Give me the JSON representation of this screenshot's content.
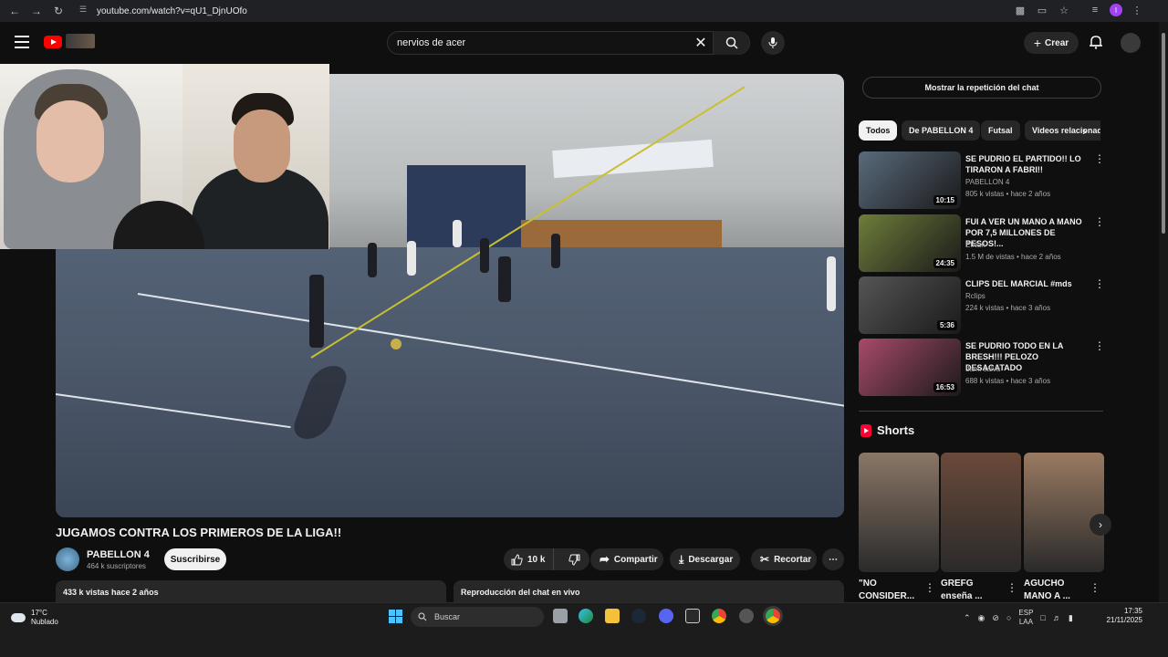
{
  "browser": {
    "url": "youtube.com/watch?v=qU1_DjnUOfo",
    "profile_initial": "I"
  },
  "header": {
    "search_value": "nervios de acer",
    "create_label": "Crear"
  },
  "video": {
    "title": "JUGAMOS CONTRA LOS PRIMEROS DE LA LIGA!!",
    "channel": "PABELLON 4",
    "subscribers": "464 k suscriptores",
    "subscribe_label": "Suscribirse",
    "likes": "10 k",
    "share_label": "Compartir",
    "download_label": "Descargar",
    "clip_label": "Recortar",
    "views_line": "433 k vistas  hace 2 años",
    "chat_replay_label": "Reproducción del chat en vivo"
  },
  "sidebar": {
    "chat_button": "Mostrar la repetición del chat",
    "chips": [
      "Todos",
      "De PABELLON 4",
      "Futsal",
      "Videos relacionados"
    ],
    "recommendations": [
      {
        "title": "SE PUDRIO EL PARTIDO!! LO TIRARON A FABRI!!",
        "channel": "PABELLON 4",
        "meta": "805 k vistas • hace 2 años",
        "duration": "10:15",
        "thumb_color": "#5a6b7c"
      },
      {
        "title": "FUI A VER UN MANO A MANO POR 7,5 MILLONES DE PESOS!...",
        "channel": "ElNari",
        "meta": "1.5 M de vistas • hace 2 años",
        "duration": "24:35",
        "thumb_color": "#6e7d3a"
      },
      {
        "title": "CLIPS DEL MARCIAL #mds",
        "channel": "Rclips",
        "meta": "224 k vistas • hace 3 años",
        "duration": "5:36",
        "thumb_color": "#555555"
      },
      {
        "title": "SE PUDRIO TODO EN LA BRESH!!! PELOZO DESACATADO",
        "channel": "dami salva",
        "meta": "688 k vistas • hace 3 años",
        "duration": "16:53",
        "thumb_color": "#a84a6a"
      }
    ],
    "shorts_label": "Shorts",
    "shorts": [
      {
        "title": "\"NO CONSIDER...",
        "thumb_color": "#8a7666"
      },
      {
        "title": "GREFG enseña ...",
        "thumb_color": "#6a4a3a"
      },
      {
        "title": "AGUCHO MANO A ...",
        "thumb_color": "#9a7a62"
      }
    ]
  },
  "taskbar": {
    "temperature": "17°C",
    "weather": "Nublado",
    "search_placeholder": "Buscar",
    "lang_top": "ESP",
    "lang_bottom": "LAA",
    "time": "17:35",
    "date": "21/11/2025"
  }
}
